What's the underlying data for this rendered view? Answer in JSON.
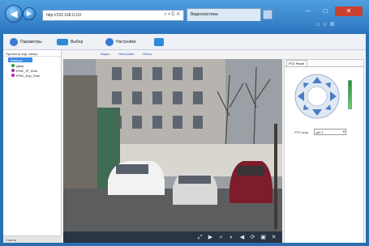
{
  "browser": {
    "address": "http://192.168.0.10/",
    "address_tools": "⌕ ▾ C ✕",
    "tab_label": "Видеосистема",
    "back_glyph": "◀",
    "forward_glyph": "▶"
  },
  "toolbar": {
    "items": [
      {
        "label": "Параметры",
        "icon": "gear-icon",
        "color": "#3a7bd5"
      },
      {
        "label": "Выбор",
        "icon": "folder-icon",
        "color": "#2f8ad8"
      },
      {
        "label": "Настройки",
        "icon": "globe-icon",
        "color": "#3a7bd5"
      },
      {
        "label": "",
        "icon": "image-icon",
        "color": "#2f8ad8"
      }
    ]
  },
  "left_panel": {
    "title": "Просмотр вид. камер",
    "root": "Камеры",
    "items": [
      {
        "label": "Двор",
        "color": "#2f9a35"
      },
      {
        "label": "IPNC_IP_Dom",
        "color": "#9b2fb0"
      },
      {
        "label": "IPNC_Exp_Dom",
        "color": "#c21fb6"
      }
    ],
    "footer": "Список"
  },
  "links": [
    "Видео",
    "Настройки",
    "Обзор"
  ],
  "video_controls": [
    "⤢",
    "▶",
    "⌕",
    "◐",
    "◀",
    "⟳",
    "▣",
    "✕"
  ],
  "ptz": {
    "tab": "PTZ Panel",
    "speed_label": "PTZ скор.",
    "speed_value": "ptz 1"
  },
  "colors": {
    "accent": "#2a6fb0",
    "selected": "#3a8ee6"
  }
}
